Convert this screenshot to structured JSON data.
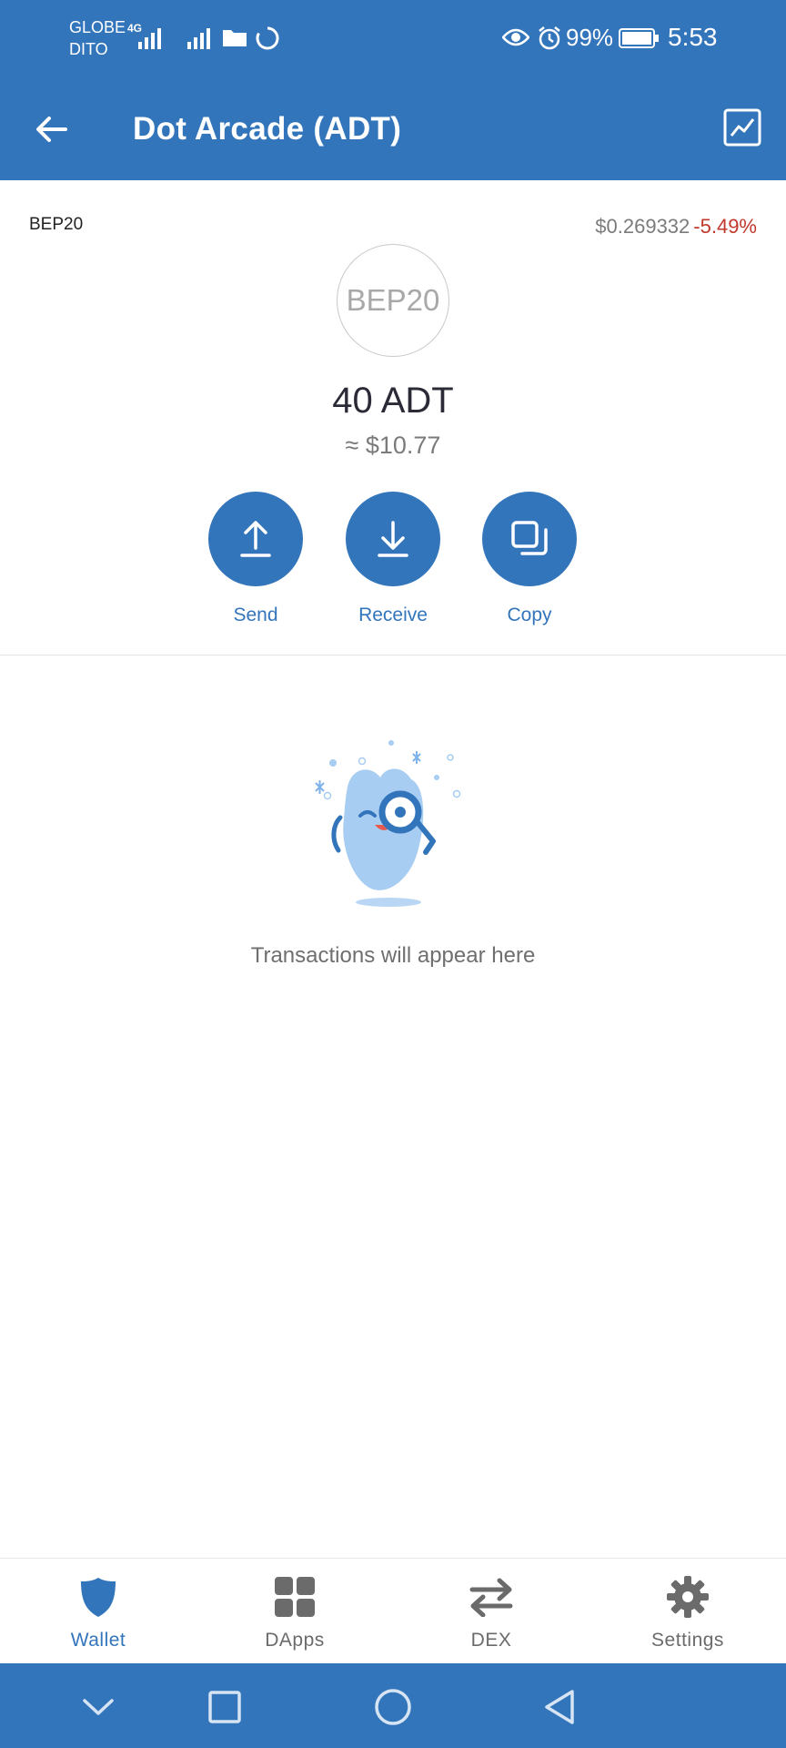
{
  "status_bar": {
    "carrier_top": "GLOBE",
    "carrier_bottom": "DITO",
    "network": "4G",
    "battery": "99%",
    "time": "5:53",
    "icons": [
      "signal-icon",
      "signal-icon",
      "folder-icon",
      "sync-icon",
      "eye-icon",
      "alarm-icon",
      "battery-icon"
    ]
  },
  "app_bar": {
    "title": "Dot Arcade (ADT)",
    "back_icon": "arrow-left-icon",
    "chart_icon": "chart-icon"
  },
  "token": {
    "network": "BEP20",
    "price": "$0.269332",
    "change": "-5.49%",
    "logo_text": "BEP20",
    "balance": "40 ADT",
    "fiat_value": "≈ $10.77"
  },
  "actions": [
    {
      "label": "Send",
      "icon": "upload-icon"
    },
    {
      "label": "Receive",
      "icon": "download-icon"
    },
    {
      "label": "Copy",
      "icon": "copy-icon"
    }
  ],
  "empty_state": {
    "message": "Transactions will appear here"
  },
  "bottom_nav": {
    "items": [
      {
        "label": "Wallet",
        "icon": "shield-icon",
        "active": true
      },
      {
        "label": "DApps",
        "icon": "grid-icon",
        "active": false
      },
      {
        "label": "DEX",
        "icon": "swap-icon",
        "active": false
      },
      {
        "label": "Settings",
        "icon": "gear-icon",
        "active": false
      }
    ]
  },
  "colors": {
    "brand": "#3375bb",
    "negative": "#c0392b"
  }
}
